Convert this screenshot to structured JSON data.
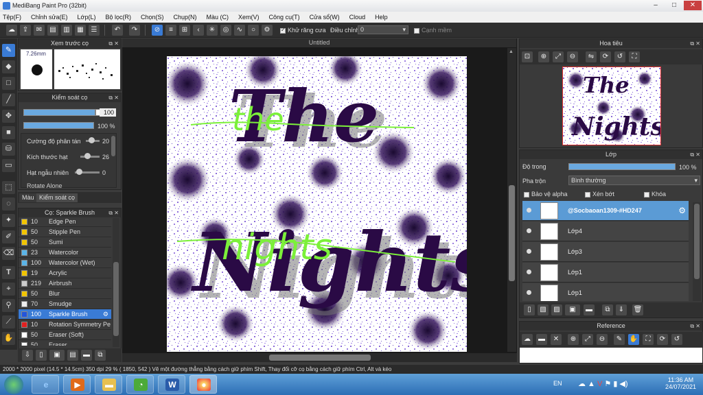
{
  "window": {
    "title": "MediBang Paint Pro (32bit)"
  },
  "menu": [
    "Tệp(F)",
    "Chỉnh sửa(E)",
    "Lớp(L)",
    "Bộ lọc(R)",
    "Chọn(S)",
    "Chụp(N)",
    "Màu (C)",
    "Xem(V)",
    "Công cụ(T)",
    "Cửa sổ(W)",
    "Cloud",
    "Help"
  ],
  "toolbar": {
    "antialias_label": "Khử răng cưa",
    "correction_label": "Điều chỉnh",
    "correction_value": "0",
    "smooth_label": "Cạnh mềm"
  },
  "brush_preview": {
    "title": "Xem trước cọ",
    "size_label": "7.26mm"
  },
  "brush_control": {
    "title": "Kiểm soát cọ",
    "size_value": "100",
    "opacity_value": "100 %",
    "options": [
      {
        "label": "Cường độ phân tán",
        "value": "20"
      },
      {
        "label": "Kích thước hạt",
        "value": "26"
      },
      {
        "label": "Hạt ngẫu nhiên",
        "value": "0"
      }
    ],
    "cut_label": "Rotate Alone"
  },
  "tabs": {
    "color": "Màu",
    "brush_control": "Kiểm soát cọ"
  },
  "brush_list": {
    "title": "Cọ: Sparkle Brush",
    "items": [
      {
        "size": "10",
        "name": "Edge Pen",
        "color": "#f2c500"
      },
      {
        "size": "50",
        "name": "Stipple Pen",
        "color": "#f2c500"
      },
      {
        "size": "50",
        "name": "Sumi",
        "color": "#f2c500"
      },
      {
        "size": "23",
        "name": "Watercolor",
        "color": "#5ab4e8"
      },
      {
        "size": "100",
        "name": "Watercolor (Wet)",
        "color": "#5ab4e8"
      },
      {
        "size": "19",
        "name": "Acrylic",
        "color": "#f2c500"
      },
      {
        "size": "219",
        "name": "Airbrush",
        "color": "#cccccc"
      },
      {
        "size": "50",
        "name": "Blur",
        "color": "#f2c500"
      },
      {
        "size": "70",
        "name": "Smudge",
        "color": "#eeeeee"
      },
      {
        "size": "100",
        "name": "Sparkle Brush",
        "color": "#2255dd"
      },
      {
        "size": "10",
        "name": "Rotation Symmetry Pe",
        "color": "#e02020"
      },
      {
        "size": "50",
        "name": "Eraser (Soft)",
        "color": "#ffffff"
      },
      {
        "size": "50",
        "name": "Eraser",
        "color": "#ffffff"
      }
    ],
    "selected_index": 9
  },
  "document": {
    "tab_title": "Untitled",
    "art_text_top": "The",
    "art_text_bottom": "Nights",
    "art_script_top": "the",
    "art_script_bottom": "nights"
  },
  "navigator": {
    "title": "Hoa tiêu"
  },
  "layer_panel": {
    "title": "Lớp",
    "opacity_label": "Độ trong",
    "opacity_value": "100 %",
    "blend_label": "Pha trộn",
    "blend_value": "Bình thường",
    "alpha_lock": "Bảo vệ alpha",
    "clipping": "Xén bớt",
    "lock": "Khóa",
    "layers": [
      {
        "name": "@Socbaoan1309-#HD247",
        "selected": true
      },
      {
        "name": "Lớp4",
        "selected": false
      },
      {
        "name": "Lớp3",
        "selected": false
      },
      {
        "name": "Lớp1",
        "selected": false
      },
      {
        "name": "Lớp1",
        "selected": false
      }
    ]
  },
  "reference": {
    "title": "Reference"
  },
  "status": {
    "text": "2000 * 2000 pixel   (14.5 * 14.5cm)   350 dpi   29 %   ( 1850, 542 )   Vẽ một đường thẳng bằng cách giữ phím Shift, Thay đổi cỡ cọ bằng cách giữ phím Ctrl, Alt và kéo"
  },
  "taskbar": {
    "lang": "EN",
    "time": "11:36 AM",
    "date": "24/07/2021"
  },
  "colors": {
    "accent": "#3a7bd5",
    "panel_bg": "#3a3a3a",
    "art_purple": "#2a0a45",
    "art_green": "#7cf03a",
    "art_speckle": "#8a6ad8"
  }
}
